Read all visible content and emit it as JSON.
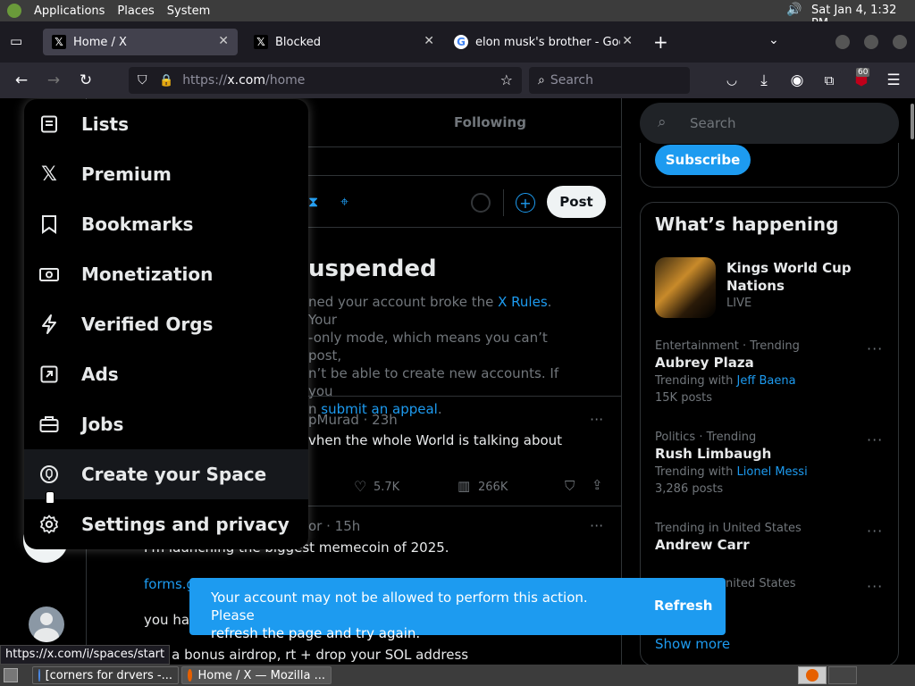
{
  "panel": {
    "applications": "Applications",
    "places": "Places",
    "system": "System",
    "clock": "Sat Jan  4,  1:32 PM"
  },
  "tabs": [
    {
      "label": "Home / X",
      "active": true
    },
    {
      "label": "Blocked",
      "active": false
    },
    {
      "label": "elon musk's brother - Googl",
      "active": false
    }
  ],
  "nav": {
    "url_prefix": "https://",
    "url_domain": "x.com",
    "url_path": "/home",
    "search_placeholder": "Search",
    "badge_count": "60"
  },
  "feed": {
    "following_tab": "Following",
    "post_button": "Post",
    "suspended_title": "uspended",
    "suspended_line1_a": "ned your account broke the ",
    "suspended_line1_link": "X Rules",
    "suspended_line1_b": ". Your",
    "suspended_line2": "-only mode, which means you can’t post,",
    "suspended_line3": "n’t be able to create new accounts. If you",
    "suspended_line4_a": "n ",
    "suspended_line4_link": "submit an appeal",
    "suspended_line4_b": ".",
    "post1_author": "pMurad · 23h",
    "post1_text": "vhen the whole World is talking about",
    "post1_likes": "5.7K",
    "post1_views": "266K",
    "post2_author": "or · 15h",
    "post2_text": "I'm launching the biggest memecoin of 2025.",
    "post2_link": "forms.g",
    "post2_line3": "you hav",
    "post2_line4": "or a bonus airdrop, rt + drop your SOL address"
  },
  "menu": {
    "items": [
      {
        "label": "Lists",
        "icon": "list-icon"
      },
      {
        "label": "Premium",
        "icon": "x-logo-icon"
      },
      {
        "label": "Bookmarks",
        "icon": "bookmark-icon"
      },
      {
        "label": "Monetization",
        "icon": "money-icon"
      },
      {
        "label": "Verified Orgs",
        "icon": "lightning-icon"
      },
      {
        "label": "Ads",
        "icon": "ads-icon"
      },
      {
        "label": "Jobs",
        "icon": "briefcase-icon"
      },
      {
        "label": "Create your Space",
        "icon": "space-mic-icon"
      },
      {
        "label": "Settings and privacy",
        "icon": "gear-icon"
      }
    ]
  },
  "sidebar": {
    "search_placeholder": "Search",
    "subscribe": "Subscribe",
    "whats_happening": "What’s happening",
    "trend0_title": "Kings World Cup Nations",
    "trend0_live": "LIVE",
    "trends": [
      {
        "category": "Entertainment · Trending",
        "name": "Aubrey Plaza",
        "with_label": "Trending with ",
        "with_link": "Jeff Baena",
        "posts": "15K posts"
      },
      {
        "category": "Politics · Trending",
        "name": "Rush Limbaugh",
        "with_label": "Trending with ",
        "with_link": "Lionel Messi",
        "posts": "3,286 posts"
      },
      {
        "category": "Trending in United States",
        "name": "Andrew Carr"
      },
      {
        "category": "nited States"
      }
    ],
    "show_more": "Show more"
  },
  "toast": {
    "message_line1": "Your account may not be allowed to perform this action. Please",
    "message_line2": "refresh the page and try again.",
    "refresh": "Refresh"
  },
  "status_url": "https://x.com/i/spaces/start",
  "taskbar": {
    "task1": "[corners for drvers -...",
    "task2": "Home / X — Mozilla ..."
  },
  "colors": {
    "accent": "#1d9bf0",
    "background": "#000000",
    "border": "#2f3336"
  }
}
